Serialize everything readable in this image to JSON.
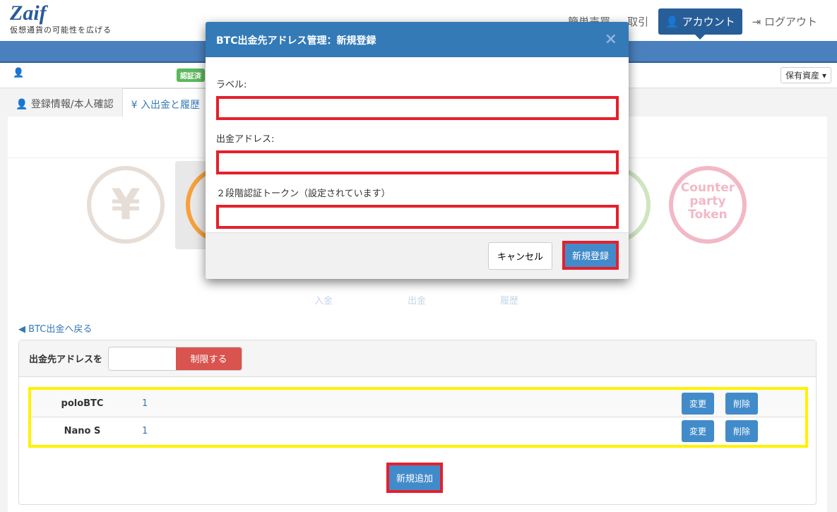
{
  "header": {
    "logo": "Zaif",
    "tagline": "仮想通貨の可能性を広げる",
    "nav": [
      {
        "label": "簡単売買"
      },
      {
        "label": "取引"
      },
      {
        "label": "アカウント",
        "active": true
      },
      {
        "label": "ログアウト"
      }
    ]
  },
  "userbar": {
    "badge": "認証済",
    "assets_label": "保有資産"
  },
  "tabs": [
    {
      "label": "登録情報/本人確認"
    },
    {
      "label": "入出金と履歴"
    }
  ],
  "coins": [
    {
      "icon": "yen-coin-icon",
      "color": "#e6ddd6"
    },
    {
      "icon": "bitcoin-coin-icon",
      "color": "#f7a03a"
    },
    {
      "icon": "monacoin-coin-icon",
      "color": "#cfe5c0"
    },
    {
      "icon": "counterparty-token-icon",
      "color": "#f2b8c6",
      "text": [
        "Counter",
        "party",
        "Token"
      ]
    }
  ],
  "subtabs": [
    "入金",
    "出金",
    "履歴"
  ],
  "back_link": "BTC出金へ戻る",
  "restrict": {
    "label": "出金先アドレスを",
    "input_value": "",
    "button": "制限する"
  },
  "addresses": [
    {
      "label": "poloBTC",
      "value": "1",
      "edit": "変更",
      "delete": "削除"
    },
    {
      "label": "Nano S",
      "value": "1",
      "edit": "変更",
      "delete": "削除"
    }
  ],
  "add_button": "新規追加",
  "modal": {
    "title": "BTC出金先アドレス管理：新規登録",
    "close": "×",
    "fields": [
      {
        "label": "ラベル:",
        "value": ""
      },
      {
        "label": "出金アドレス:",
        "value": ""
      },
      {
        "label": "２段階認証トークン（設定されています）",
        "value": ""
      }
    ],
    "cancel": "キャンセル",
    "submit": "新規登録"
  },
  "colors": {
    "primary": "#337ab7",
    "danger": "#d9534f",
    "highlight_red": "#e5202c",
    "highlight_yellow": "#fff200"
  }
}
